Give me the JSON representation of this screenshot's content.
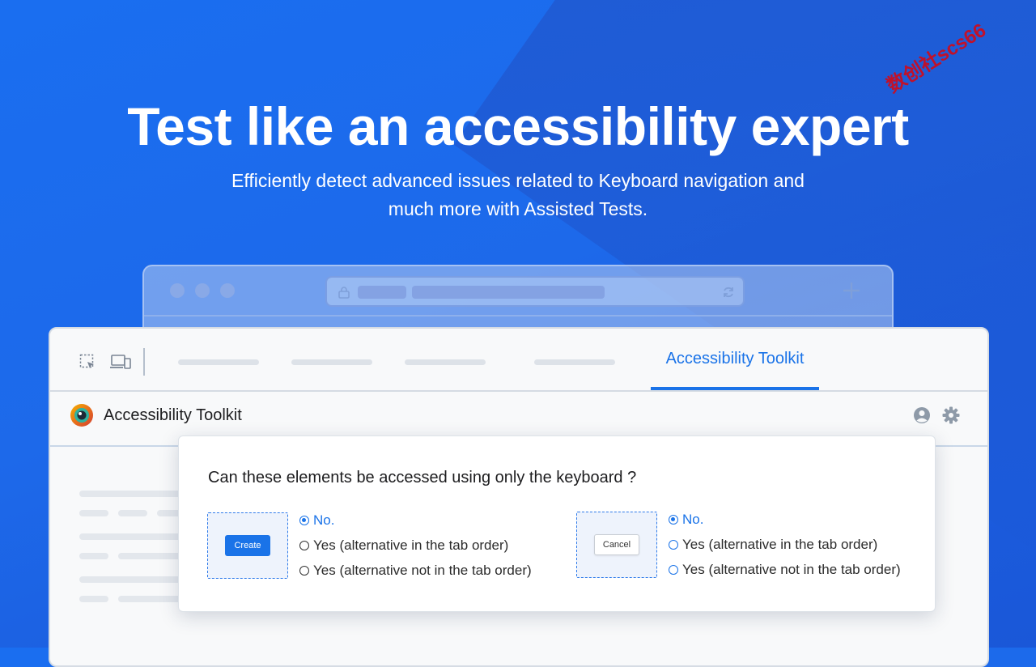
{
  "hero": {
    "title": "Test like an accessibility expert",
    "subtitle_line1": "Efficiently detect advanced issues related to Keyboard navigation and",
    "subtitle_line2": "much more with Assisted Tests."
  },
  "watermark": "数创社scs66",
  "devtools": {
    "active_tab_label": "Accessibility Toolkit",
    "panel_title": "Accessibility Toolkit"
  },
  "dialog": {
    "question": "Can these elements be accessed using only the keyboard ?",
    "items": [
      {
        "preview_button_label": "Create",
        "options": [
          "No.",
          "Yes (alternative in the tab order)",
          "Yes (alternative not in the tab order)"
        ],
        "selected": "No."
      },
      {
        "preview_button_label": "Cancel",
        "options": [
          "No.",
          "Yes (alternative in the tab order)",
          "Yes (alternative not in the tab order)"
        ],
        "selected": "No."
      }
    ]
  },
  "colors": {
    "accent": "#1a73e8",
    "background": "#1a6ef0",
    "watermark": "#c0112b"
  },
  "icons": [
    "lock-icon",
    "reload-icon",
    "new-tab-plus-icon",
    "inspect-element-icon",
    "device-toggle-icon",
    "toolkit-logo-icon",
    "account-icon",
    "settings-gear-icon"
  ]
}
